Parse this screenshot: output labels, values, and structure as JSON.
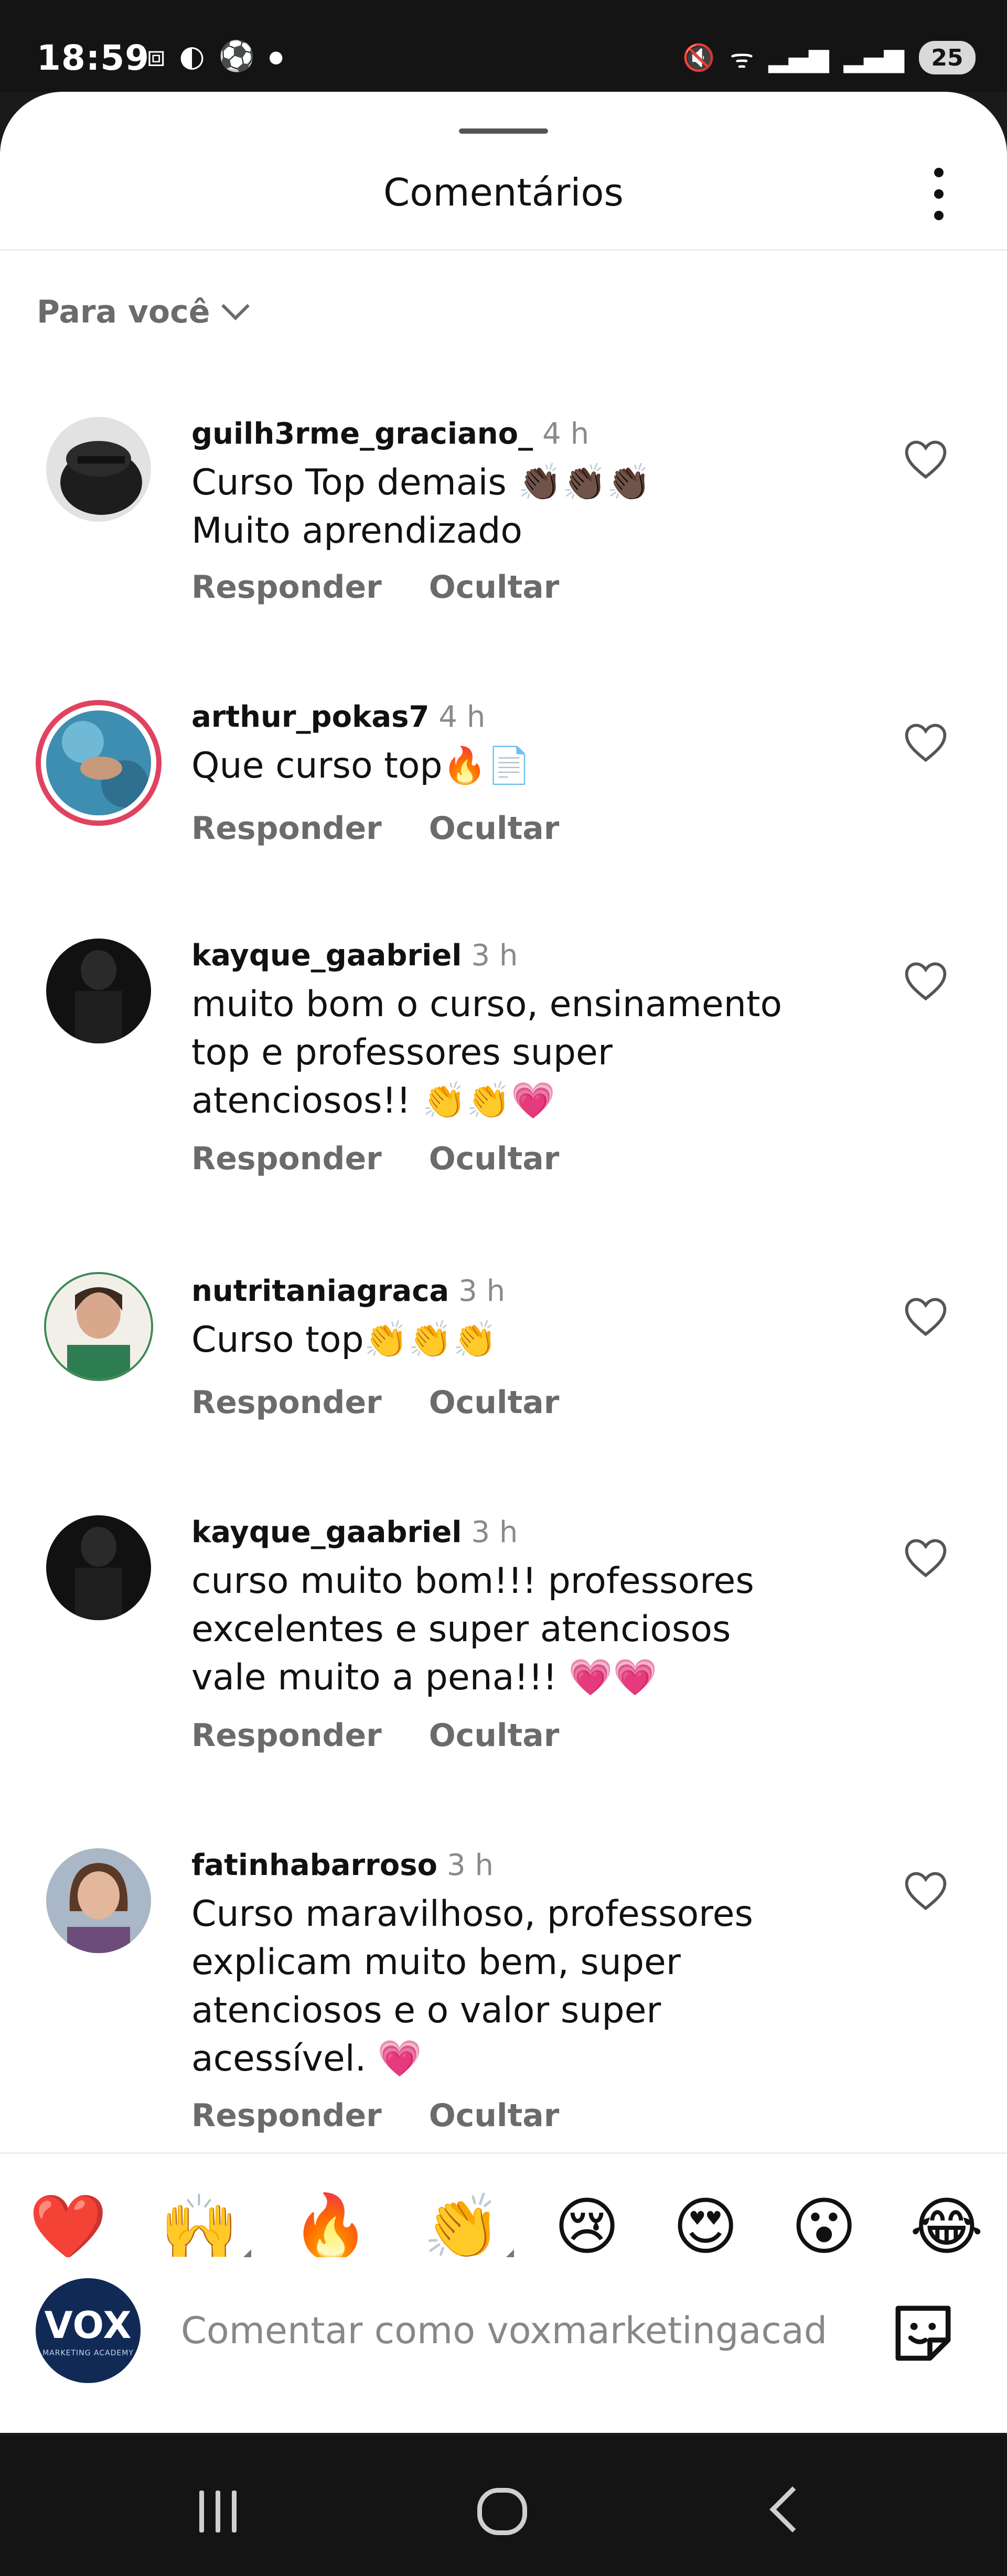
{
  "status_bar": {
    "time": "18:59",
    "left_icons": [
      "screenshot-icon",
      "dark-mode-icon",
      "soccer-ball-icon",
      "notification-dot"
    ],
    "right_icons": [
      "mute-icon",
      "wifi-icon",
      "signal-5g-icon",
      "signal-5g-icon"
    ],
    "battery": "25"
  },
  "sheet": {
    "title": "Comentários",
    "filter_label": "Para você"
  },
  "comments": [
    {
      "username": "guilh3rme_graciano_",
      "time": "4 h",
      "text": "Curso Top demais 👏🏿👏🏿👏🏿\nMuito aprendizado",
      "reply": "Responder",
      "hide": "Ocultar"
    },
    {
      "username": "arthur_pokas7",
      "time": "4 h",
      "text": "Que curso top🔥📄",
      "reply": "Responder",
      "hide": "Ocultar"
    },
    {
      "username": "kayque_gaabriel",
      "time": "3 h",
      "text": "muito bom o curso, ensinamento\ntop e professores super\natenciosos!! 👏👏💗",
      "reply": "Responder",
      "hide": "Ocultar"
    },
    {
      "username": "nutritaniagraca",
      "time": "3 h",
      "text": "Curso top👏👏👏",
      "reply": "Responder",
      "hide": "Ocultar"
    },
    {
      "username": "kayque_gaabriel",
      "time": "3 h",
      "text": "curso muito bom!!! professores\nexcelentes e super atenciosos\nvale muito a pena!!! 💗💗",
      "reply": "Responder",
      "hide": "Ocultar"
    },
    {
      "username": "fatinhabarroso",
      "time": "3 h",
      "text": "Curso maravilhoso, professores\nexplicam muito bem, super\natenciosos e o valor super\nacessível. 💗",
      "reply": "Responder",
      "hide": "Ocultar"
    }
  ],
  "reactions": [
    "❤️",
    "🙌",
    "🔥",
    "👏",
    "😢",
    "😍",
    "😮",
    "😂"
  ],
  "composer": {
    "avatar_text": "VOX",
    "avatar_subtext": "MARKETING ACADEMY",
    "placeholder": "Comentar como voxmarketingacad"
  },
  "colors": {
    "accent_ring": "#e0435f",
    "muted_text": "#6b6b6b",
    "avatar_brand": "#112a55"
  }
}
